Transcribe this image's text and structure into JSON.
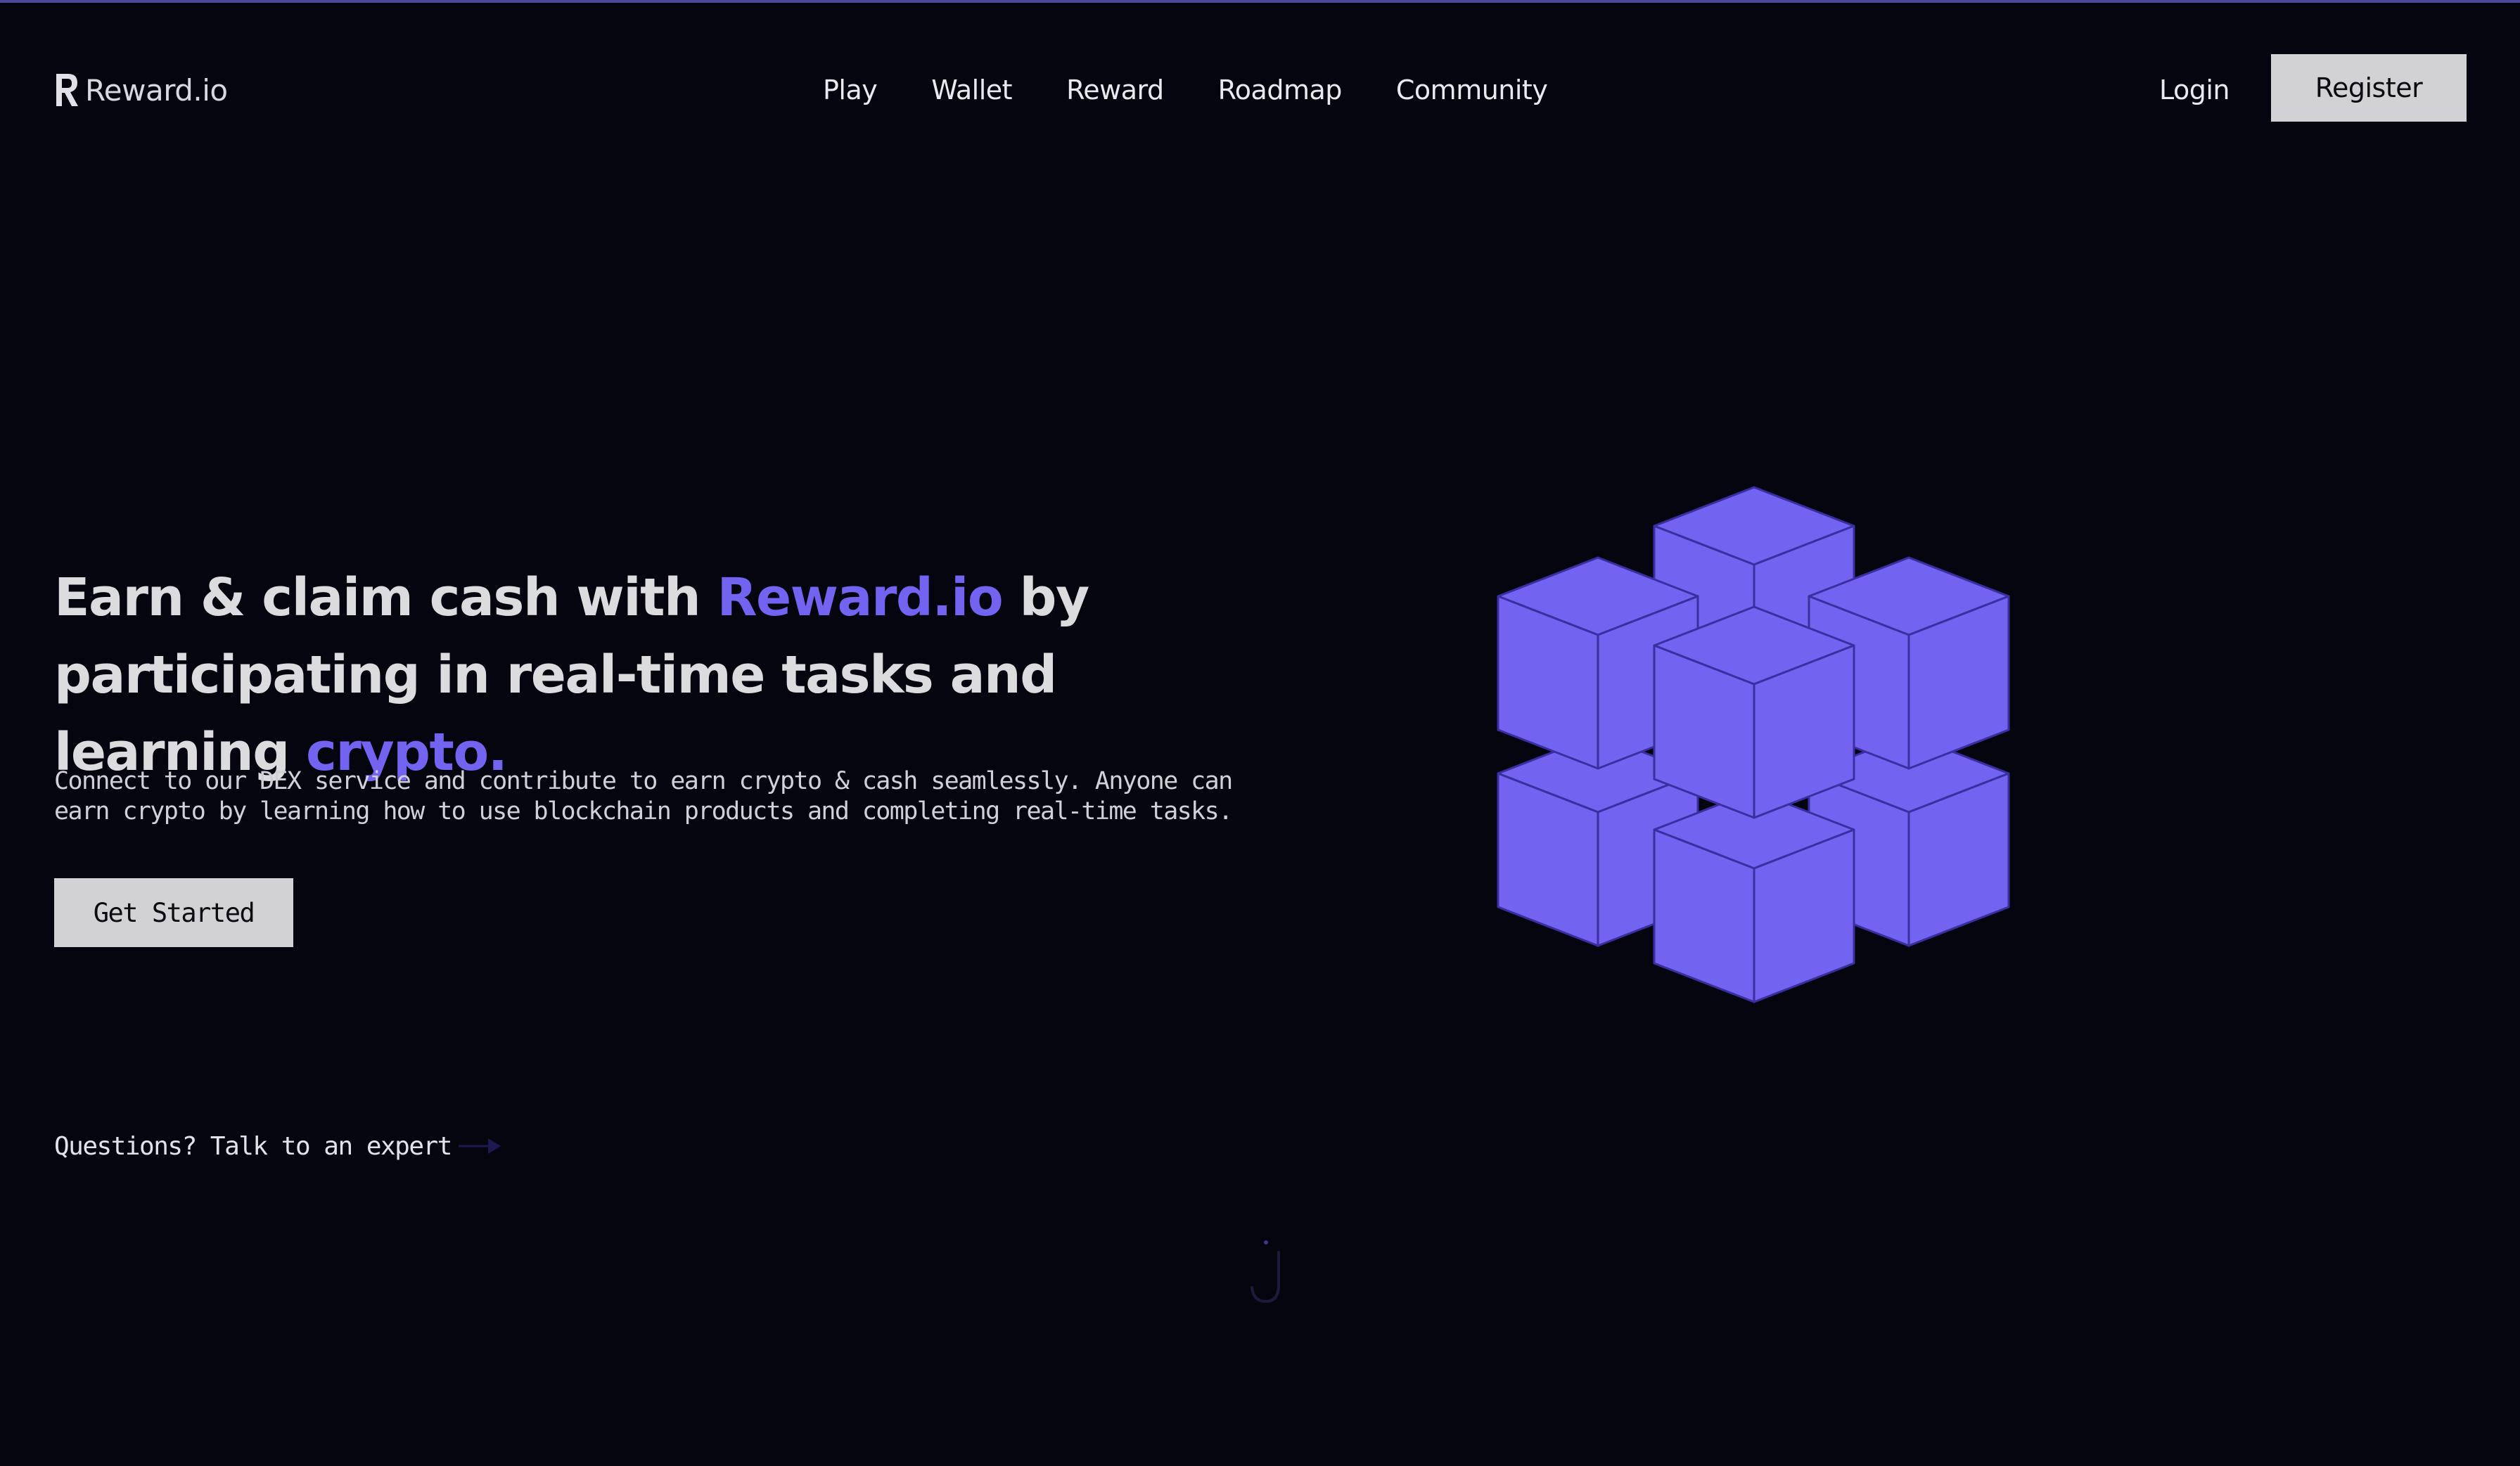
{
  "header": {
    "logo_text": "Reward.io",
    "logo_icon": "r-logo-icon",
    "nav": [
      {
        "label": "Play"
      },
      {
        "label": "Wallet"
      },
      {
        "label": "Reward"
      },
      {
        "label": "Roadmap"
      },
      {
        "label": "Community"
      }
    ],
    "login_label": "Login",
    "register_label": "Register"
  },
  "hero": {
    "title_part1": "Earn & claim cash with ",
    "title_accent1": "Reward.io",
    "title_part2": " by participating in real-time tasks and learning ",
    "title_accent2": "crypto.",
    "description": "Connect to our DEX service and contribute to earn crypto & cash seamlessly. Anyone can earn crypto by learning how to use blockchain products and completing real-time tasks.",
    "cta_label": "Get Started",
    "expert_link": "Questions? Talk to an expert",
    "illustration_icon": "cube-cluster-illustration",
    "scroll_icon": "scroll-down-icon"
  },
  "colors": {
    "background": "#05050f",
    "accent": "#7264f0",
    "cube_fill": "#7264f0",
    "cube_stroke": "#3a2fa0",
    "button_bg": "#d2d2d4",
    "top_border": "#4c4799"
  }
}
